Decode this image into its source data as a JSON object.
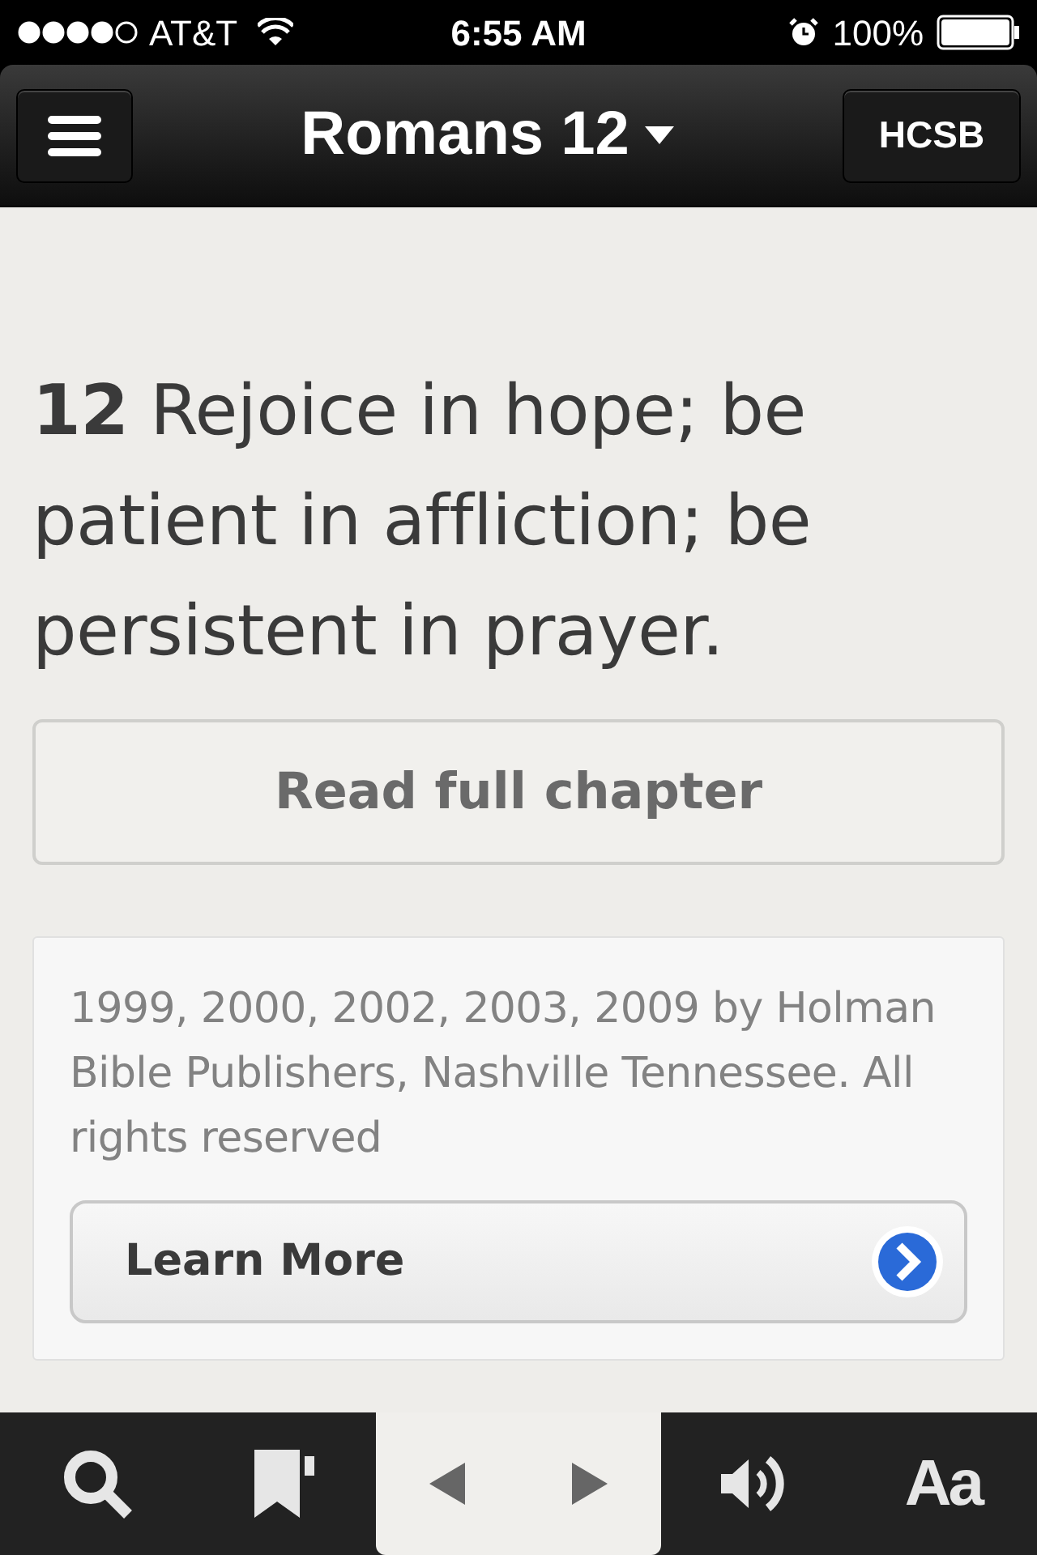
{
  "status_bar": {
    "carrier": "AT&T",
    "time": "6:55 AM",
    "battery": "100%"
  },
  "nav": {
    "title": "Romans 12",
    "version": "HCSB"
  },
  "verse": {
    "text": "**12** Rejoice in hope; be patient in affliction; be persistent in prayer."
  },
  "read_button": "Read full chapter",
  "copyright": {
    "text": "1999, 2000, 2002, 2003, 2009 by Holman Bible Publishers, Nashville Tennessee. All rights reserved",
    "button": "Learn More"
  },
  "toolbar": {
    "font_button": "Aa"
  }
}
